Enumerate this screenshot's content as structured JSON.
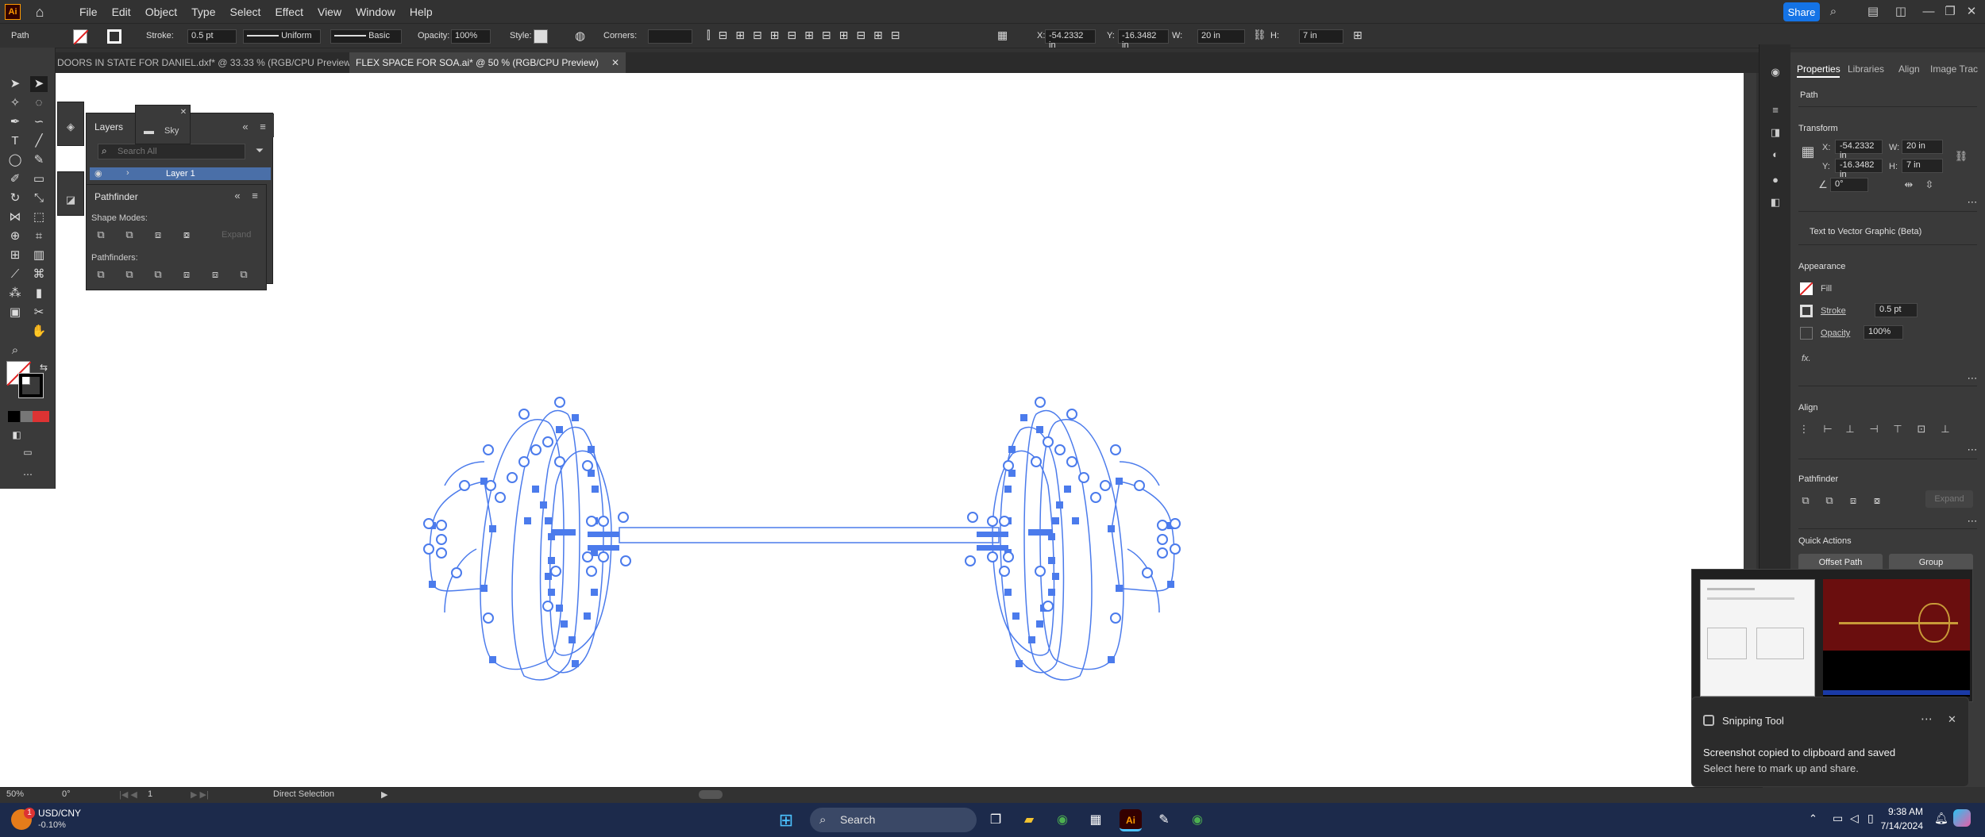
{
  "app": {
    "logo": "Ai",
    "share": "Share"
  },
  "menu": [
    "File",
    "Edit",
    "Object",
    "Type",
    "Select",
    "Effect",
    "View",
    "Window",
    "Help"
  ],
  "control": {
    "selection": "Path",
    "stroke_label": "Stroke:",
    "stroke_value": "0.5 pt",
    "profile": "Uniform",
    "brush": "Basic",
    "opacity_label": "Opacity:",
    "opacity_value": "100%",
    "style_label": "Style:",
    "corners_label": "Corners:",
    "x_label": "X:",
    "x_value": "-54.2332 in",
    "y_label": "Y:",
    "y_value": "-16.3482 in",
    "w_label": "W:",
    "w_value": "20 in",
    "h_label": "H:",
    "h_value": "7 in"
  },
  "tabs": [
    {
      "label": "DOORS IN STATE FOR DANIEL.dxf* @ 33.33 % (RGB/CPU Preview)",
      "active": false
    },
    {
      "label": "FLEX SPACE FOR SOA.ai* @ 50 % (RGB/CPU Preview)",
      "active": true
    }
  ],
  "layers_panel": {
    "title": "Layers",
    "search_placeholder": "Search All",
    "layer_name": "Layer 1",
    "flyout_label": "Sky"
  },
  "pathfinder_panel": {
    "title": "Pathfinder",
    "shape_modes": "Shape Modes:",
    "expand": "Expand",
    "pathfinders": "Pathfinders:"
  },
  "properties": {
    "tabs": [
      "Properties",
      "Libraries",
      "Align",
      "Image Trac"
    ],
    "selection": "Path",
    "transform": "Transform",
    "x_label": "X:",
    "x_value": "-54.2332 in",
    "y_label": "Y:",
    "y_value": "-16.3482 in",
    "w_label": "W:",
    "w_value": "20 in",
    "h_label": "H:",
    "h_value": "7 in",
    "angle_value": "0°",
    "text_to_vector": "Text to Vector Graphic (Beta)",
    "appearance": "Appearance",
    "fill": "Fill",
    "stroke": "Stroke",
    "stroke_value": "0.5 pt",
    "opacity": "Opacity",
    "opacity_value": "100%",
    "fx": "fx.",
    "align": "Align",
    "pathfinder": "Pathfinder",
    "pf_expand": "Expand",
    "quick_actions": "Quick Actions",
    "offset_path": "Offset Path",
    "group": "Group"
  },
  "status": {
    "zoom": "50%",
    "rotate": "0°",
    "artboard": "1",
    "tool": "Direct Selection"
  },
  "toast": {
    "app": "Snipping Tool",
    "line1": "Screenshot copied to clipboard and saved",
    "line2": "Select here to mark up and share."
  },
  "taskbar": {
    "ticker_name": "USD/CNY",
    "ticker_change": "-0.10%",
    "ticker_badge": "1",
    "search": "Search",
    "time": "9:38 AM",
    "date": "7/14/2024"
  },
  "colors": {
    "accent": "#1473e6",
    "path_blue": "#4b7bec",
    "canvas": "#ffffff",
    "ui_dark": "#323232"
  }
}
